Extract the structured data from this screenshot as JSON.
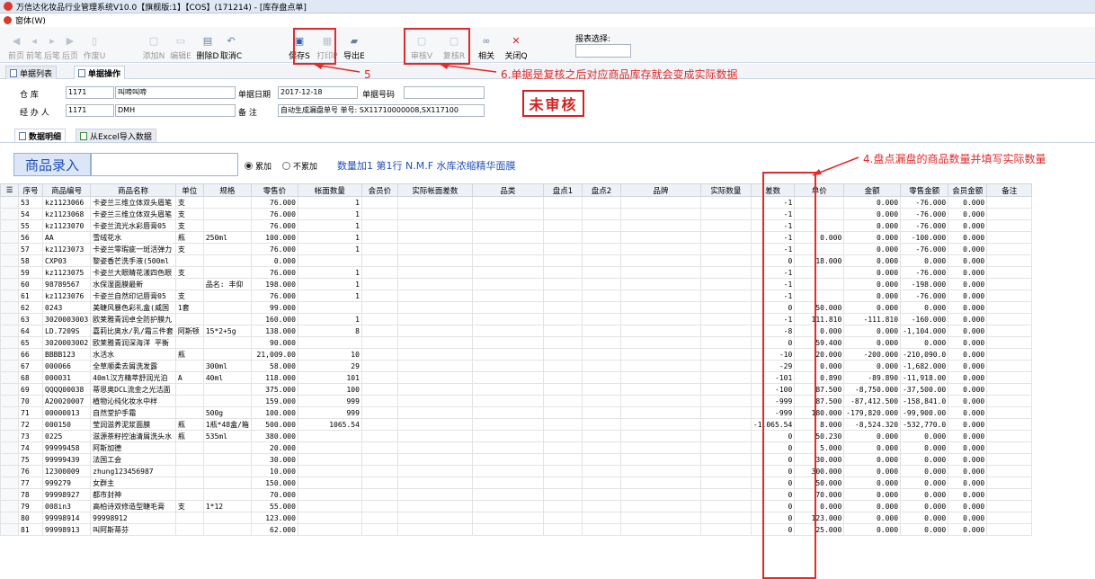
{
  "window": {
    "title": "万信达化妆品行业管理系统V10.0【旗舰版:1】【COS】(171214) - [库存盘点单]"
  },
  "menu": {
    "window_label": "窗体(W)"
  },
  "toolbar": {
    "items": [
      {
        "label": "前页",
        "icon": "first-page-icon",
        "enabled": false
      },
      {
        "label": "前笔",
        "icon": "prev-icon",
        "enabled": false
      },
      {
        "label": "后笔",
        "icon": "next-icon",
        "enabled": false
      },
      {
        "label": "后页",
        "icon": "last-page-icon",
        "enabled": false
      },
      {
        "label": "作废U",
        "icon": "void-icon",
        "enabled": false
      },
      {
        "label": "添加N",
        "icon": "add-icon",
        "enabled": false
      },
      {
        "label": "编辑E",
        "icon": "edit-icon",
        "enabled": false
      },
      {
        "label": "删除D",
        "icon": "delete-icon",
        "enabled": true
      },
      {
        "label": "取消C",
        "icon": "undo-icon",
        "enabled": true
      },
      {
        "label": "保存S",
        "icon": "save-icon",
        "enabled": true
      },
      {
        "label": "打印P",
        "icon": "print-icon",
        "enabled": false
      },
      {
        "label": "导出E",
        "icon": "export-icon",
        "enabled": true
      },
      {
        "label": "审核V",
        "icon": "audit-icon",
        "enabled": false
      },
      {
        "label": "复核R",
        "icon": "review-icon",
        "enabled": false
      },
      {
        "label": "相关",
        "icon": "link-icon",
        "enabled": true
      },
      {
        "label": "关闭Q",
        "icon": "close-icon",
        "enabled": true
      }
    ],
    "report_label": "报表选择:"
  },
  "tabs": {
    "list": "单据列表",
    "ops": "单据操作"
  },
  "form": {
    "warehouse_label": "仓    库",
    "warehouse_code": "1171",
    "warehouse_name": "叫啼叫啼",
    "date_label": "单据日期",
    "date_value": "2017-12-18",
    "docno_label": "单据号码",
    "docno_value": "",
    "handler_label": "经 办 人",
    "handler_code": "1171",
    "handler_name": "DMH",
    "remark_label": "备    注",
    "remark_value": "自动生成漏盘单号  单号: SX11710000008,SX117100",
    "status": "未审核"
  },
  "subtabs": {
    "detail": "数据明细",
    "excel": "从Excel导入数据"
  },
  "entry": {
    "title": "商品录入",
    "radio_add": "累加",
    "radio_noadd": "不累加",
    "info": "数量加1 第1行  N.M.F 水库浓缩精华面膜"
  },
  "annotations": {
    "a5": "5",
    "a6": "6.单据是复核之后对应商品库存就会变成实际数据",
    "a4": "4.盘点漏盘的商品数量并填写实际数量"
  },
  "table": {
    "headers": [
      "序号",
      "商品编号",
      "商品名称",
      "单位",
      "规格",
      "零售价",
      "帐面数量",
      "会员价",
      "实际帐面差数",
      "品类",
      "盘点1",
      "盘点2",
      "品牌",
      "实际数量",
      "差数",
      "单价",
      "金额",
      "零售金额",
      "会员金额",
      "备注"
    ],
    "rows": [
      [
        "53",
        "kz1123066",
        "卡姿兰三维立体双头眉笔",
        "支",
        "",
        "76.000",
        "1",
        "",
        "",
        "",
        "",
        "",
        "",
        "",
        "-1",
        "",
        "0.000",
        "-76.000",
        "0.000",
        ""
      ],
      [
        "54",
        "kz1123068",
        "卡姿兰三维立体双头眉笔",
        "支",
        "",
        "76.000",
        "1",
        "",
        "",
        "",
        "",
        "",
        "",
        "",
        "-1",
        "",
        "0.000",
        "-76.000",
        "0.000",
        ""
      ],
      [
        "55",
        "kz1123070",
        "卡姿兰流光水彩唇膏05",
        "支",
        "",
        "76.000",
        "1",
        "",
        "",
        "",
        "",
        "",
        "",
        "",
        "-1",
        "",
        "0.000",
        "-76.000",
        "0.000",
        ""
      ],
      [
        "56",
        "AA",
        "雪绒花水",
        "瓶",
        "250ml",
        "100.000",
        "1",
        "",
        "",
        "",
        "",
        "",
        "",
        "",
        "-1",
        "0.000",
        "0.000",
        "-100.000",
        "0.000",
        ""
      ],
      [
        "57",
        "kz1123073",
        "卡姿兰零瑕疵一斑活弹力",
        "支",
        "",
        "76.000",
        "1",
        "",
        "",
        "",
        "",
        "",
        "",
        "",
        "-1",
        "",
        "0.000",
        "-76.000",
        "0.000",
        ""
      ],
      [
        "58",
        "CXP03",
        "黎姿香芒洗手液(500ml",
        "",
        "",
        "0.000",
        "",
        "",
        "",
        "",
        "",
        "",
        "",
        "",
        "0",
        "18.000",
        "0.000",
        "0.000",
        "0.000",
        ""
      ],
      [
        "59",
        "kz1123075",
        "卡姿兰大眼睛花漾四色眼",
        "支",
        "",
        "76.000",
        "1",
        "",
        "",
        "",
        "",
        "",
        "",
        "",
        "-1",
        "",
        "0.000",
        "-76.000",
        "0.000",
        ""
      ],
      [
        "60",
        "98789567",
        "水保湿面膜最新",
        "",
        "品名: 丰仰",
        "198.000",
        "1",
        "",
        "",
        "",
        "",
        "",
        "",
        "",
        "-1",
        "",
        "0.000",
        "-198.000",
        "0.000",
        ""
      ],
      [
        "61",
        "kz1123076",
        "卡姿兰自然印记唇膏05",
        "支",
        "",
        "76.000",
        "1",
        "",
        "",
        "",
        "",
        "",
        "",
        "",
        "-1",
        "",
        "0.000",
        "-76.000",
        "0.000",
        ""
      ],
      [
        "62",
        "0243",
        "美睫风暴色彩礼盒(威国",
        "1套",
        "",
        "99.000",
        "",
        "",
        "",
        "",
        "",
        "",
        "",
        "",
        "0",
        "50.000",
        "0.000",
        "0.000",
        "0.000",
        ""
      ],
      [
        "63",
        "3020003003",
        "欧莱雅青润卓全防护膜九",
        "",
        "",
        "160.000",
        "1",
        "",
        "",
        "",
        "",
        "",
        "",
        "",
        "-1",
        "111.810",
        "-111.810",
        "-160.000",
        "0.000",
        ""
      ],
      [
        "64",
        "LD.7209S",
        "嘉莉比奥水/乳/霜三件套",
        "阿斯顿",
        "15*2+5g",
        "138.000",
        "8",
        "",
        "",
        "",
        "",
        "",
        "",
        "",
        "-8",
        "0.000",
        "0.000",
        "-1,104.000",
        "0.000",
        ""
      ],
      [
        "65",
        "3020003002",
        "欧莱雅青润深海洋 平衡",
        "",
        "",
        "90.000",
        "",
        "",
        "",
        "",
        "",
        "",
        "",
        "",
        "0",
        "59.400",
        "0.000",
        "0.000",
        "0.000",
        ""
      ],
      [
        "66",
        "BBBB123",
        "水活水",
        "瓶",
        "",
        "21,009.00",
        "10",
        "",
        "",
        "",
        "",
        "",
        "",
        "",
        "-10",
        "20.000",
        "-200.000",
        "-210,090.0",
        "0.000",
        ""
      ],
      [
        "67",
        "000066",
        "全草顺柔去屑洗发露",
        "",
        "300ml",
        "58.000",
        "29",
        "",
        "",
        "",
        "",
        "",
        "",
        "",
        "-29",
        "0.000",
        "0.000",
        "-1,682.000",
        "0.000",
        ""
      ],
      [
        "68",
        "000031",
        "40ml汉方精萃舒润光泊",
        "A",
        "40ml",
        "118.000",
        "101",
        "",
        "",
        "",
        "",
        "",
        "",
        "",
        "-101",
        "0.890",
        "-89.890",
        "-11,918.00",
        "0.000",
        ""
      ],
      [
        "69",
        "QQQQ00038",
        "蒂恩奥DCL流金之光洁面",
        "",
        "",
        "375.000",
        "100",
        "",
        "",
        "",
        "",
        "",
        "",
        "",
        "-100",
        "87.500",
        "-8,750.000",
        "-37,500.00",
        "0.000",
        ""
      ],
      [
        "70",
        "A20020007",
        "植物沁纯化妆水中样",
        "",
        "",
        "159.000",
        "999",
        "",
        "",
        "",
        "",
        "",
        "",
        "",
        "-999",
        "87.500",
        "-87,412.500",
        "-158,841.0",
        "0.000",
        ""
      ],
      [
        "71",
        "00000013",
        "自然堂护手霜",
        "",
        "500g",
        "100.000",
        "999",
        "",
        "",
        "",
        "",
        "",
        "",
        "",
        "-999",
        "180.000",
        "-179,820.000",
        "-99,900.00",
        "0.000",
        ""
      ],
      [
        "72",
        "000150",
        "莹润滋养泥浆面膜",
        "瓶",
        "1瓶*48盒/箱",
        "500.000",
        "1065.54",
        "",
        "",
        "",
        "",
        "",
        "",
        "",
        "-1,065.54",
        "8.000",
        "-8,524.320",
        "-532,770.0",
        "0.000",
        ""
      ],
      [
        "73",
        "0225",
        "滋源茶籽控油清屑洗头水",
        "瓶",
        "535ml",
        "380.000",
        "",
        "",
        "",
        "",
        "",
        "",
        "",
        "",
        "0",
        "50.230",
        "0.000",
        "0.000",
        "0.000",
        ""
      ],
      [
        "74",
        "99999458",
        "阿斯加德",
        "",
        "",
        "20.000",
        "",
        "",
        "",
        "",
        "",
        "",
        "",
        "",
        "0",
        "5.000",
        "0.000",
        "0.000",
        "0.000",
        ""
      ],
      [
        "75",
        "99999439",
        "法国工会",
        "",
        "",
        "30.000",
        "",
        "",
        "",
        "",
        "",
        "",
        "",
        "",
        "0",
        "30.000",
        "0.000",
        "0.000",
        "0.000",
        ""
      ],
      [
        "76",
        "12300009",
        "zhung123456987",
        "",
        "",
        "10.000",
        "",
        "",
        "",
        "",
        "",
        "",
        "",
        "",
        "0",
        "300.000",
        "0.000",
        "0.000",
        "0.000",
        ""
      ],
      [
        "77",
        "999279",
        "女群主",
        "",
        "",
        "150.000",
        "",
        "",
        "",
        "",
        "",
        "",
        "",
        "",
        "0",
        "50.000",
        "0.000",
        "0.000",
        "0.000",
        ""
      ],
      [
        "78",
        "99998927",
        "都市封神",
        "",
        "",
        "70.000",
        "",
        "",
        "",
        "",
        "",
        "",
        "",
        "",
        "0",
        "70.000",
        "0.000",
        "0.000",
        "0.000",
        ""
      ],
      [
        "79",
        "008in3",
        "高柏诗双修造型睫毛膏",
        "支",
        "1*12",
        "55.000",
        "",
        "",
        "",
        "",
        "",
        "",
        "",
        "",
        "0",
        "0.000",
        "0.000",
        "0.000",
        "0.000",
        ""
      ],
      [
        "80",
        "99998914",
        "99998912",
        "",
        "",
        "123.000",
        "",
        "",
        "",
        "",
        "",
        "",
        "",
        "",
        "0",
        "123.000",
        "0.000",
        "0.000",
        "0.000",
        ""
      ],
      [
        "81",
        "99998913",
        "叫阿斯蒂芬",
        "",
        "",
        "62.000",
        "",
        "",
        "",
        "",
        "",
        "",
        "",
        "",
        "0",
        "25.000",
        "0.000",
        "0.000",
        "0.000",
        ""
      ]
    ]
  },
  "colors": {
    "accent_red": "#e22a2a",
    "entry_blue": "#2050b8"
  }
}
